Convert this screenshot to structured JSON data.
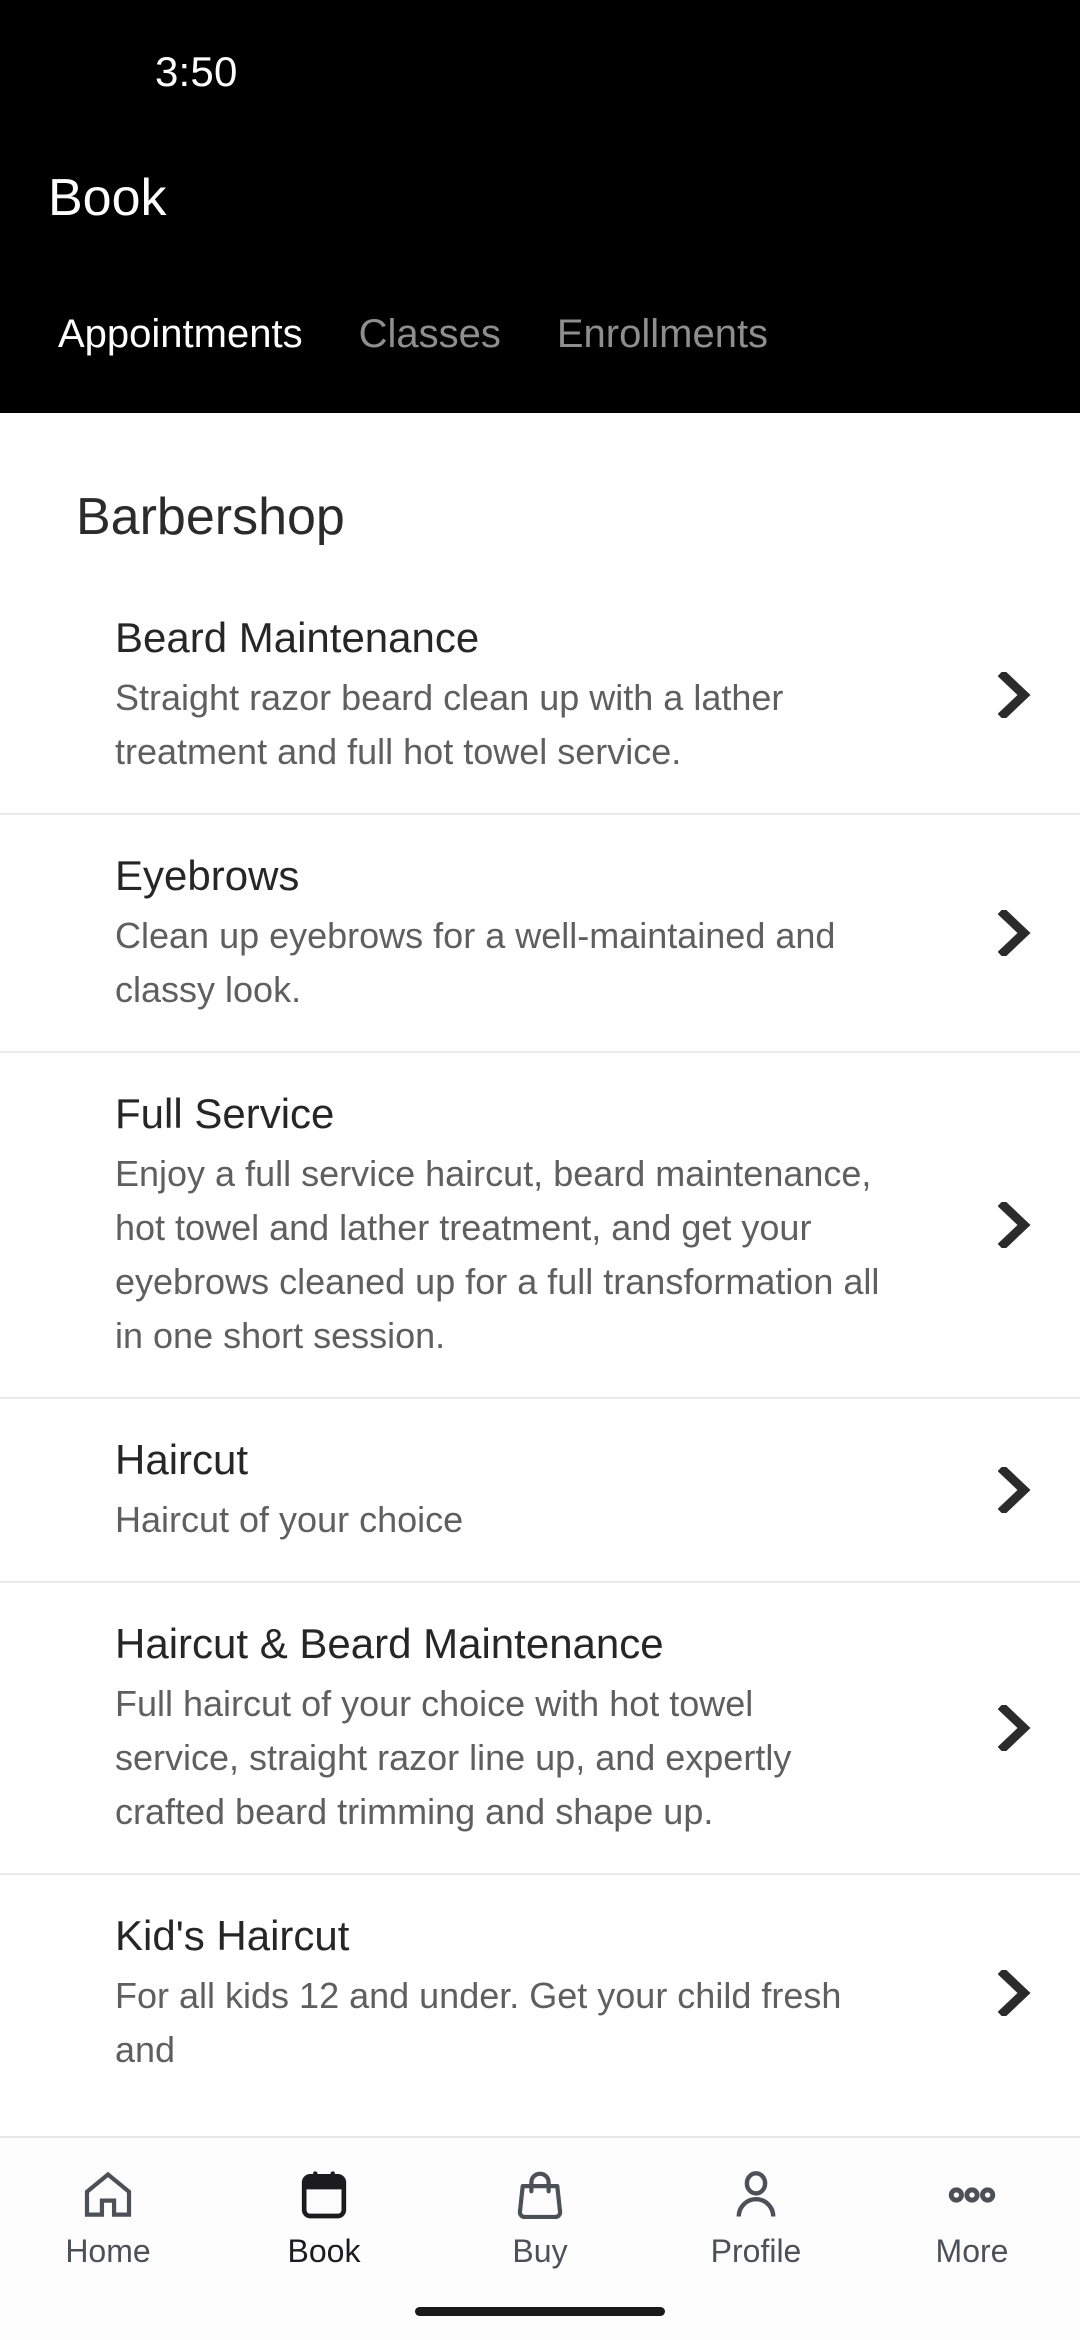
{
  "status_bar": {
    "clock": "3:50"
  },
  "header": {
    "title": "Book",
    "tabs": [
      {
        "label": "Appointments",
        "active": true
      },
      {
        "label": "Classes",
        "active": false
      },
      {
        "label": "Enrollments",
        "active": false
      }
    ]
  },
  "main": {
    "section_title": "Barbershop",
    "services": [
      {
        "title": "Beard Maintenance",
        "description": "Straight razor beard clean up with a lather treatment and full hot towel service."
      },
      {
        "title": "Eyebrows",
        "description": "Clean up eyebrows for a well-maintained and classy look."
      },
      {
        "title": "Full Service",
        "description": "Enjoy a full service haircut, beard maintenance, hot towel and lather treatment, and get your eyebrows cleaned up for a full transformation all in one short session."
      },
      {
        "title": "Haircut",
        "description": "Haircut of your choice"
      },
      {
        "title": "Haircut & Beard Maintenance",
        "description": "Full haircut of your choice with hot towel service, straight razor line up, and expertly crafted beard trimming and shape up."
      },
      {
        "title": "Kid's Haircut",
        "description": "For all kids 12 and under. Get your child fresh and"
      }
    ],
    "row_chevron_icon": "chevron-right-icon"
  },
  "bottom_nav": [
    {
      "label": "Home",
      "icon": "home-icon",
      "active": false
    },
    {
      "label": "Book",
      "icon": "calendar-icon",
      "active": true
    },
    {
      "label": "Buy",
      "icon": "shopping-bag-icon",
      "active": false
    },
    {
      "label": "Profile",
      "icon": "person-icon",
      "active": false
    },
    {
      "label": "More",
      "icon": "ellipsis-icon",
      "active": false
    }
  ],
  "colors": {
    "header_background": "#000000",
    "header_text": "#ffffff",
    "inactive_tab_text": "#8e8e8e",
    "content_background": "#ffffff",
    "title_text": "#262626",
    "description_text": "#5f5f5f",
    "divider": "#e9e9e9",
    "nav_inactive": "#4c5158",
    "nav_active": "#1c1c1e"
  }
}
